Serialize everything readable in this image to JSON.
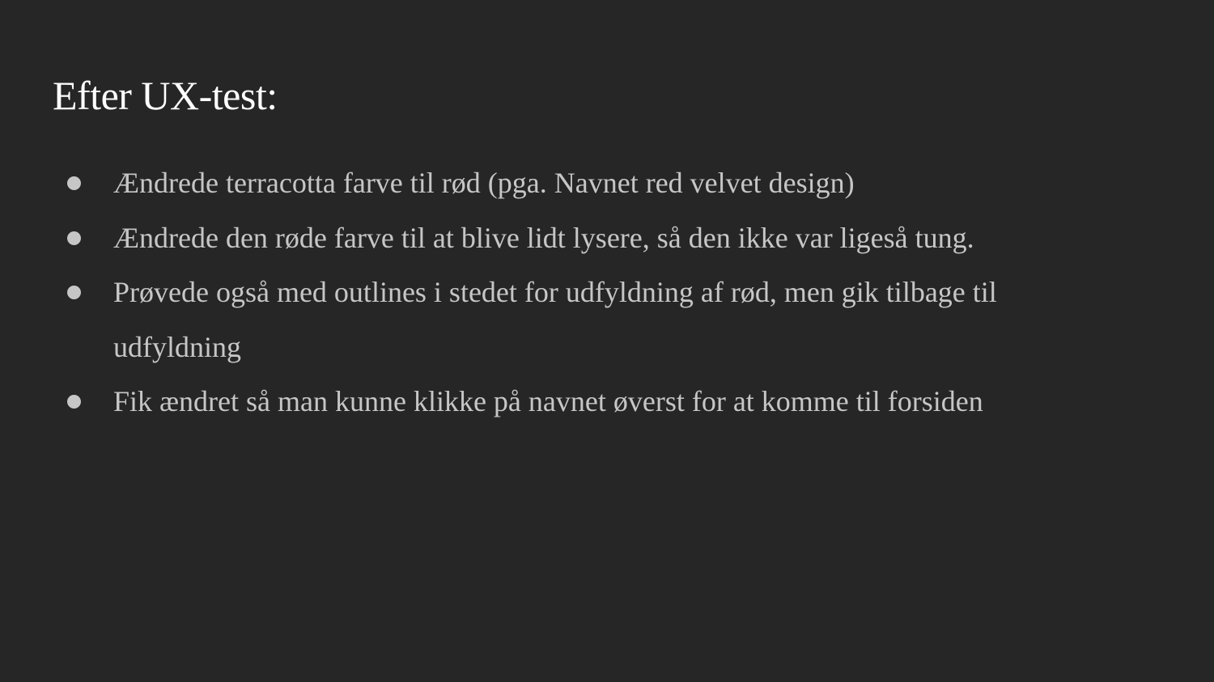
{
  "slide": {
    "title": "Efter UX-test:",
    "bullets": [
      "Ændrede terracotta farve til rød (pga. Navnet red velvet design)",
      "Ændrede den røde farve til at blive lidt lysere, så den ikke var ligeså tung.",
      "Prøvede også med outlines i stedet for udfyldning af rød, men gik tilbage til udfyldning",
      "Fik ændret så man kunne klikke på navnet øverst for at komme til forsiden"
    ]
  },
  "colors": {
    "background": "#262626",
    "title": "#ffffff",
    "body_text": "#c6c6c6"
  }
}
